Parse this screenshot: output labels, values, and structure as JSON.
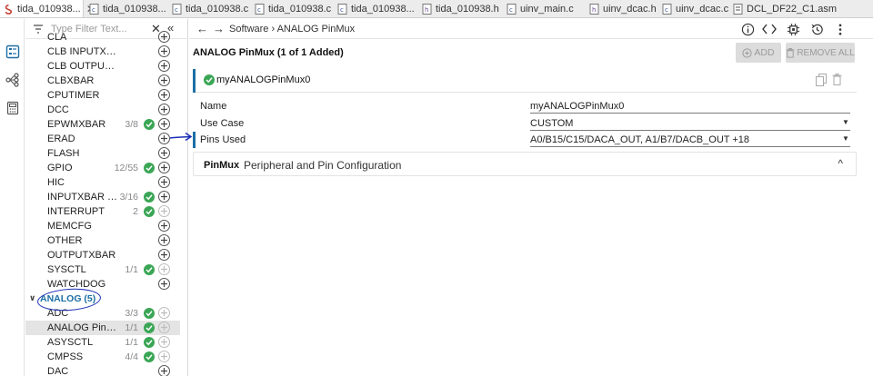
{
  "tabs": [
    {
      "label": "tida_010938...",
      "close": "✕",
      "icon": "syscfg-icon"
    },
    {
      "label": "tida_010938...",
      "icon": "c-file-icon"
    },
    {
      "label": "tida_010938.c",
      "icon": "c-file-icon"
    },
    {
      "label": "tida_010938.c",
      "icon": "c-file-icon"
    },
    {
      "label": "tida_010938...",
      "icon": "c-file-icon"
    },
    {
      "label": "tida_010938.h",
      "icon": "h-file-icon"
    },
    {
      "label": "uinv_main.c",
      "icon": "c-file-icon"
    },
    {
      "label": "uinv_dcac.h",
      "icon": "h-file-icon"
    },
    {
      "label": "uinv_dcac.c",
      "icon": "c-file-icon"
    },
    {
      "label": "DCL_DF22_C1.asm",
      "icon": "asm-file-icon"
    }
  ],
  "sidebar": {
    "filter_placeholder": "Type Filter Text...",
    "clear_label": "✕",
    "collapse_label": "«",
    "items": [
      {
        "label": "CLA",
        "count": "",
        "check": false
      },
      {
        "label": "CLB INPUTXBAR INPUT",
        "count": "",
        "check": false
      },
      {
        "label": "CLB OUTPUTXBAR",
        "count": "",
        "check": false
      },
      {
        "label": "CLBXBAR",
        "count": "",
        "check": false
      },
      {
        "label": "CPUTIMER",
        "count": "",
        "check": false
      },
      {
        "label": "DCC",
        "count": "",
        "check": false
      },
      {
        "label": "EPWMXBAR",
        "count": "3/8",
        "check": true
      },
      {
        "label": "ERAD",
        "count": "",
        "check": false
      },
      {
        "label": "FLASH",
        "count": "",
        "check": false
      },
      {
        "label": "GPIO",
        "count": "12/55",
        "check": true
      },
      {
        "label": "HIC",
        "count": "",
        "check": false
      },
      {
        "label": "INPUTXBAR IN...",
        "count": "3/16",
        "check": true
      },
      {
        "label": "INTERRUPT",
        "count": "2",
        "check": true,
        "plus_dim": true
      },
      {
        "label": "MEMCFG",
        "count": "",
        "check": false
      },
      {
        "label": "OTHER",
        "count": "",
        "check": false
      },
      {
        "label": "OUTPUTXBAR",
        "count": "",
        "check": false
      },
      {
        "label": "SYSCTL",
        "count": "1/1",
        "check": true,
        "plus_dim": true
      },
      {
        "label": "WATCHDOG",
        "count": "",
        "check": false
      }
    ],
    "group": {
      "label": "ANALOG (5)",
      "chevron": "∨"
    },
    "group_items": [
      {
        "label": "ADC",
        "count": "3/3",
        "check": true
      },
      {
        "label": "ANALOG PinMux",
        "count": "1/1",
        "check": true,
        "selected": true
      },
      {
        "label": "ASYSCTL",
        "count": "1/1",
        "check": true
      },
      {
        "label": "CMPSS",
        "count": "4/4",
        "check": true
      },
      {
        "label": "DAC",
        "count": "",
        "check": false
      }
    ]
  },
  "header": {
    "back": "←",
    "forward": "→",
    "breadcrumb": "Software › ANALOG PinMux",
    "icons": [
      "info-icon",
      "code-icon",
      "chip-icon",
      "history-icon",
      "more-icon"
    ]
  },
  "content": {
    "title": "ANALOG PinMux (1 of 1 Added)",
    "add_label": "ADD",
    "remove_all_label": "REMOVE ALL",
    "instance_name": "myANALOGPinMux0",
    "props": {
      "name_label": "Name",
      "name_value": "myANALOGPinMux0",
      "usecase_label": "Use Case",
      "usecase_value": "CUSTOM",
      "pins_label": "Pins Used",
      "pins_value": "A0/B15/C15/DACA_OUT, A1/B7/DACB_OUT +18"
    },
    "section": {
      "title": "PinMux",
      "desc": "Peripheral and Pin Configuration",
      "caret": "^"
    }
  },
  "colors": {
    "accent": "#1d6fa5",
    "check_green": "#3aa655",
    "annotation_blue": "#1b2fb5"
  }
}
